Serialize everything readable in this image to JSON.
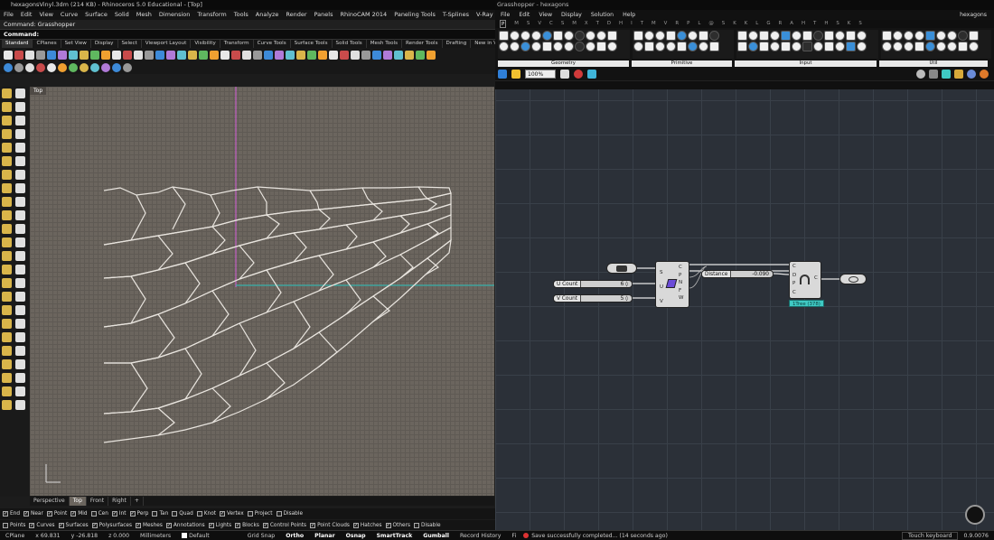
{
  "rhino": {
    "title": "hexagonsVinyl.3dm (214 KB) - Rhinoceros 5.0 Educational - [Top]",
    "menu": [
      "File",
      "Edit",
      "View",
      "Curve",
      "Surface",
      "Solid",
      "Mesh",
      "Dimension",
      "Transform",
      "Tools",
      "Analyze",
      "Render",
      "Panels",
      "RhinoCAM 2014",
      "Paneling Tools",
      "T-Splines",
      "V-Ray",
      "Help"
    ],
    "command_history": "Command: Grasshopper",
    "command_prompt": "Command:",
    "toolbar_tabs": [
      "Standard",
      "CPlanes",
      "Set View",
      "Display",
      "Select",
      "Viewport Layout",
      "Visibility",
      "Transform",
      "Curve Tools",
      "Surface Tools",
      "Solid Tools",
      "Mesh Tools",
      "Render Tools",
      "Drafting",
      "New in V5"
    ],
    "viewport_label": "Top",
    "view_tabs": [
      "Perspective",
      "Top",
      "Front",
      "Right"
    ],
    "osnap_row1": [
      "End",
      "Near",
      "Point",
      "Mid",
      "Cen",
      "Int",
      "Perp",
      "Tan",
      "Quad",
      "Knot",
      "Vertex",
      "Project",
      "Disable"
    ],
    "osnap_row1_checked": [
      true,
      true,
      true,
      true,
      false,
      true,
      true,
      false,
      false,
      false,
      true,
      false,
      false
    ],
    "osnap_row2": [
      "Points",
      "Curves",
      "Surfaces",
      "Polysurfaces",
      "Meshes",
      "Annotations",
      "Lights",
      "Blocks",
      "Control Points",
      "Point Clouds",
      "Hatches",
      "Others",
      "Disable"
    ],
    "osnap_row2_checked": [
      false,
      true,
      true,
      true,
      true,
      true,
      true,
      true,
      true,
      true,
      true,
      true,
      false
    ],
    "status": {
      "cplane": "CPlane",
      "x": "x 69.831",
      "y": "y -26.818",
      "z": "z 0.000",
      "units": "Millimeters",
      "layer": "Default",
      "grid_snap": "Grid Snap",
      "ortho": "Ortho",
      "planar": "Planar",
      "osnap": "Osnap",
      "smarttrack": "SmartTrack",
      "gumball": "Gumball",
      "record_history": "Record History",
      "filter": "Fi"
    }
  },
  "gh": {
    "title": "Grasshopper - hexagons",
    "menu": [
      "File",
      "Edit",
      "View",
      "Display",
      "Solution",
      "Help"
    ],
    "doc_name": "hexagons",
    "tab_letters": [
      "P",
      "M",
      "S",
      "V",
      "C",
      "S",
      "M",
      "X",
      "T",
      "D",
      "H",
      "I",
      "T",
      "M",
      "V",
      "R",
      "P",
      "L",
      "@",
      "S",
      "K",
      "K",
      "L",
      "G",
      "R",
      "A",
      "H",
      "T",
      "H",
      "S",
      "K",
      "S"
    ],
    "groups": [
      "Geometry",
      "Primitive",
      "Input",
      "Util"
    ],
    "zoom": "100%",
    "nodes": {
      "slider_u_label": "U Count",
      "slider_u_value": "6 ◊",
      "slider_v_label": "V Count",
      "slider_v_value": "5 ◊",
      "slider_dist_label": "Distance",
      "slider_dist_value": "-0.090",
      "panel_inputs": [
        "S",
        "U",
        "V"
      ],
      "panel_outputs": [
        "C",
        "P",
        "N",
        "F",
        "W"
      ],
      "offset_inputs": [
        "C",
        "D",
        "P",
        "C"
      ],
      "offset_output": "C",
      "hint": "1Tree (378)"
    },
    "status_message": "Save successfully completed... (14 seconds ago)",
    "touch_keyboard": "Touch keyboard",
    "version": "0.9.0076"
  },
  "colors": {
    "viewport_bg": "#6b655e",
    "canvas_bg": "#2b3038",
    "hex_curves": "#e8e4de",
    "x_axis": "#2fc9c3",
    "y_axis": "#d05ad6"
  }
}
